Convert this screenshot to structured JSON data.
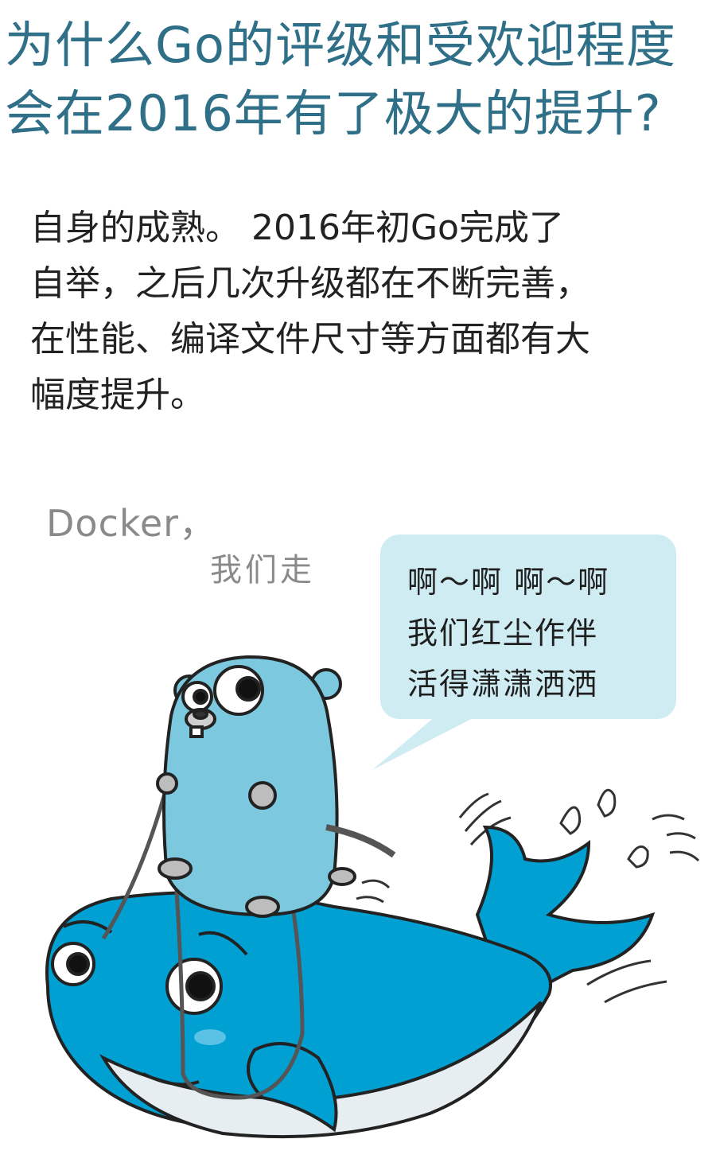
{
  "title": {
    "line1": "为什么Go的评级和受欢迎程度",
    "line2": "会在2016年有了极大的提升?"
  },
  "paragraph": {
    "line1": "自身的成熟。 2016年初Go完成了",
    "line2": "自举，之后几次升级都在不断完善，",
    "line3": "在性能、编译文件尺寸等方面都有大",
    "line4": "幅度提升。"
  },
  "illustration": {
    "caption_line1": "Docker，",
    "caption_line2": "我们走",
    "bubble": {
      "line1": "啊～啊  啊～啊",
      "line2": "我们红尘作伴",
      "line3": "活得潇潇洒洒"
    },
    "colors": {
      "gopher": "#7cc8df",
      "whale": "#00a0d2",
      "bubble": "#cfecf3",
      "title": "#2f7088"
    },
    "icons": [
      "gopher-character",
      "whale-character"
    ]
  }
}
